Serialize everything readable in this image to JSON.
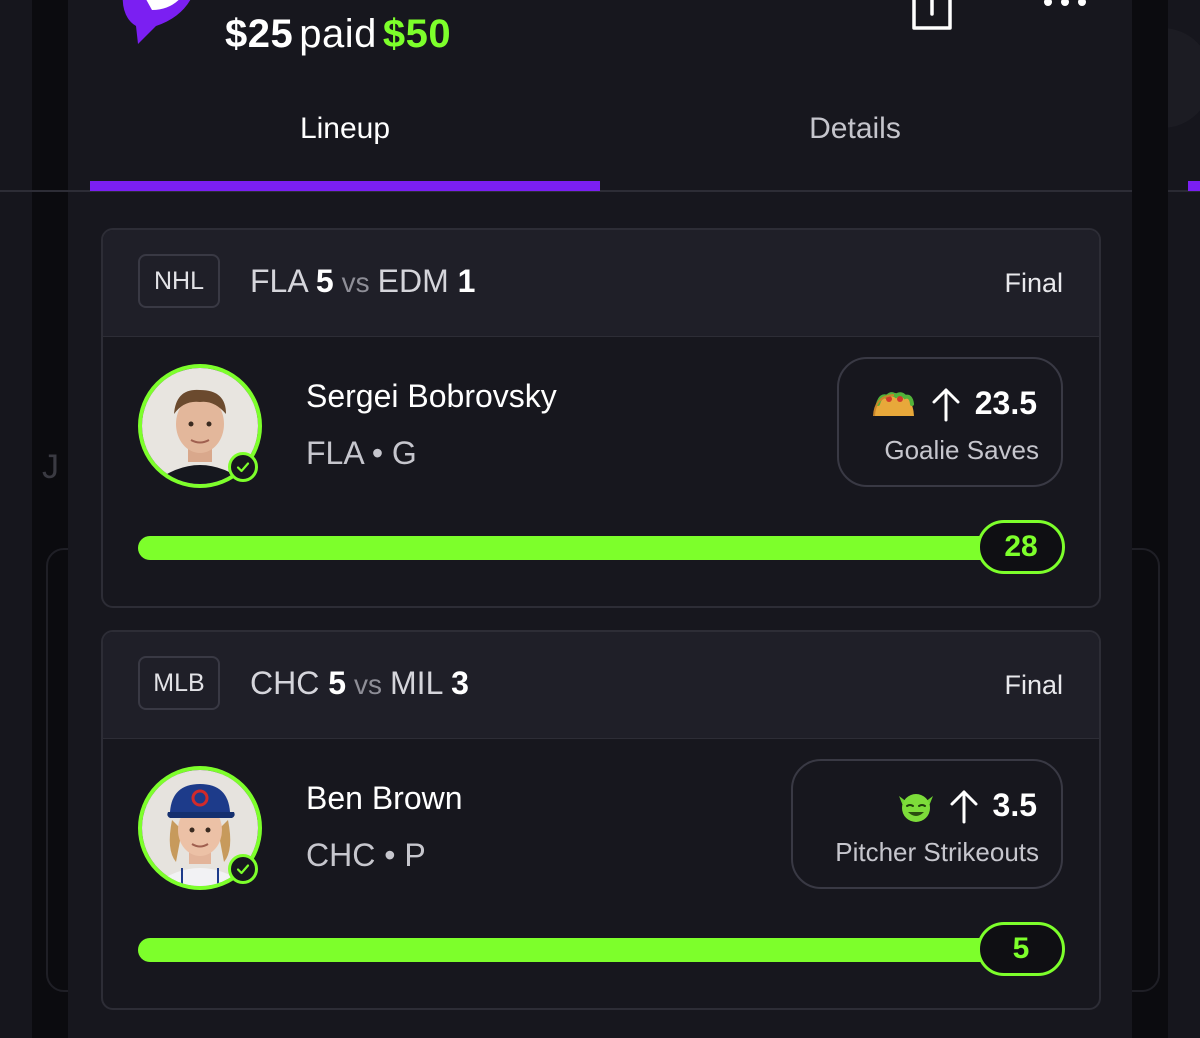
{
  "header": {
    "entry_amount": "$25",
    "paid_label": "paid",
    "payout_amount": "$50"
  },
  "tabs": [
    {
      "label": "Lineup",
      "active": true
    },
    {
      "label": "Details",
      "active": false
    }
  ],
  "colors": {
    "accent_green": "#7dff2b",
    "accent_purple": "#7b1ff2"
  },
  "picks": [
    {
      "league": "NHL",
      "team1": "FLA",
      "score1": "5",
      "vs": "vs",
      "team2": "EDM",
      "score2": "1",
      "status": "Final",
      "player_name": "Sergei Bobrovsky",
      "player_meta": "FLA • G",
      "pick_icon": "taco-emoji-icon",
      "direction_icon": "arrow-up-icon",
      "line": "23.5",
      "stat": "Goalie Saves",
      "result": "28",
      "progress": 1.0
    },
    {
      "league": "MLB",
      "team1": "CHC",
      "score1": "5",
      "vs": "vs",
      "team2": "MIL",
      "score2": "3",
      "status": "Final",
      "player_name": "Ben Brown",
      "player_meta": "CHC • P",
      "pick_icon": "goblin-emoji-icon",
      "direction_icon": "arrow-up-icon",
      "line": "3.5",
      "stat": "Pitcher Strikeouts",
      "result": "5",
      "progress": 1.0
    }
  ]
}
